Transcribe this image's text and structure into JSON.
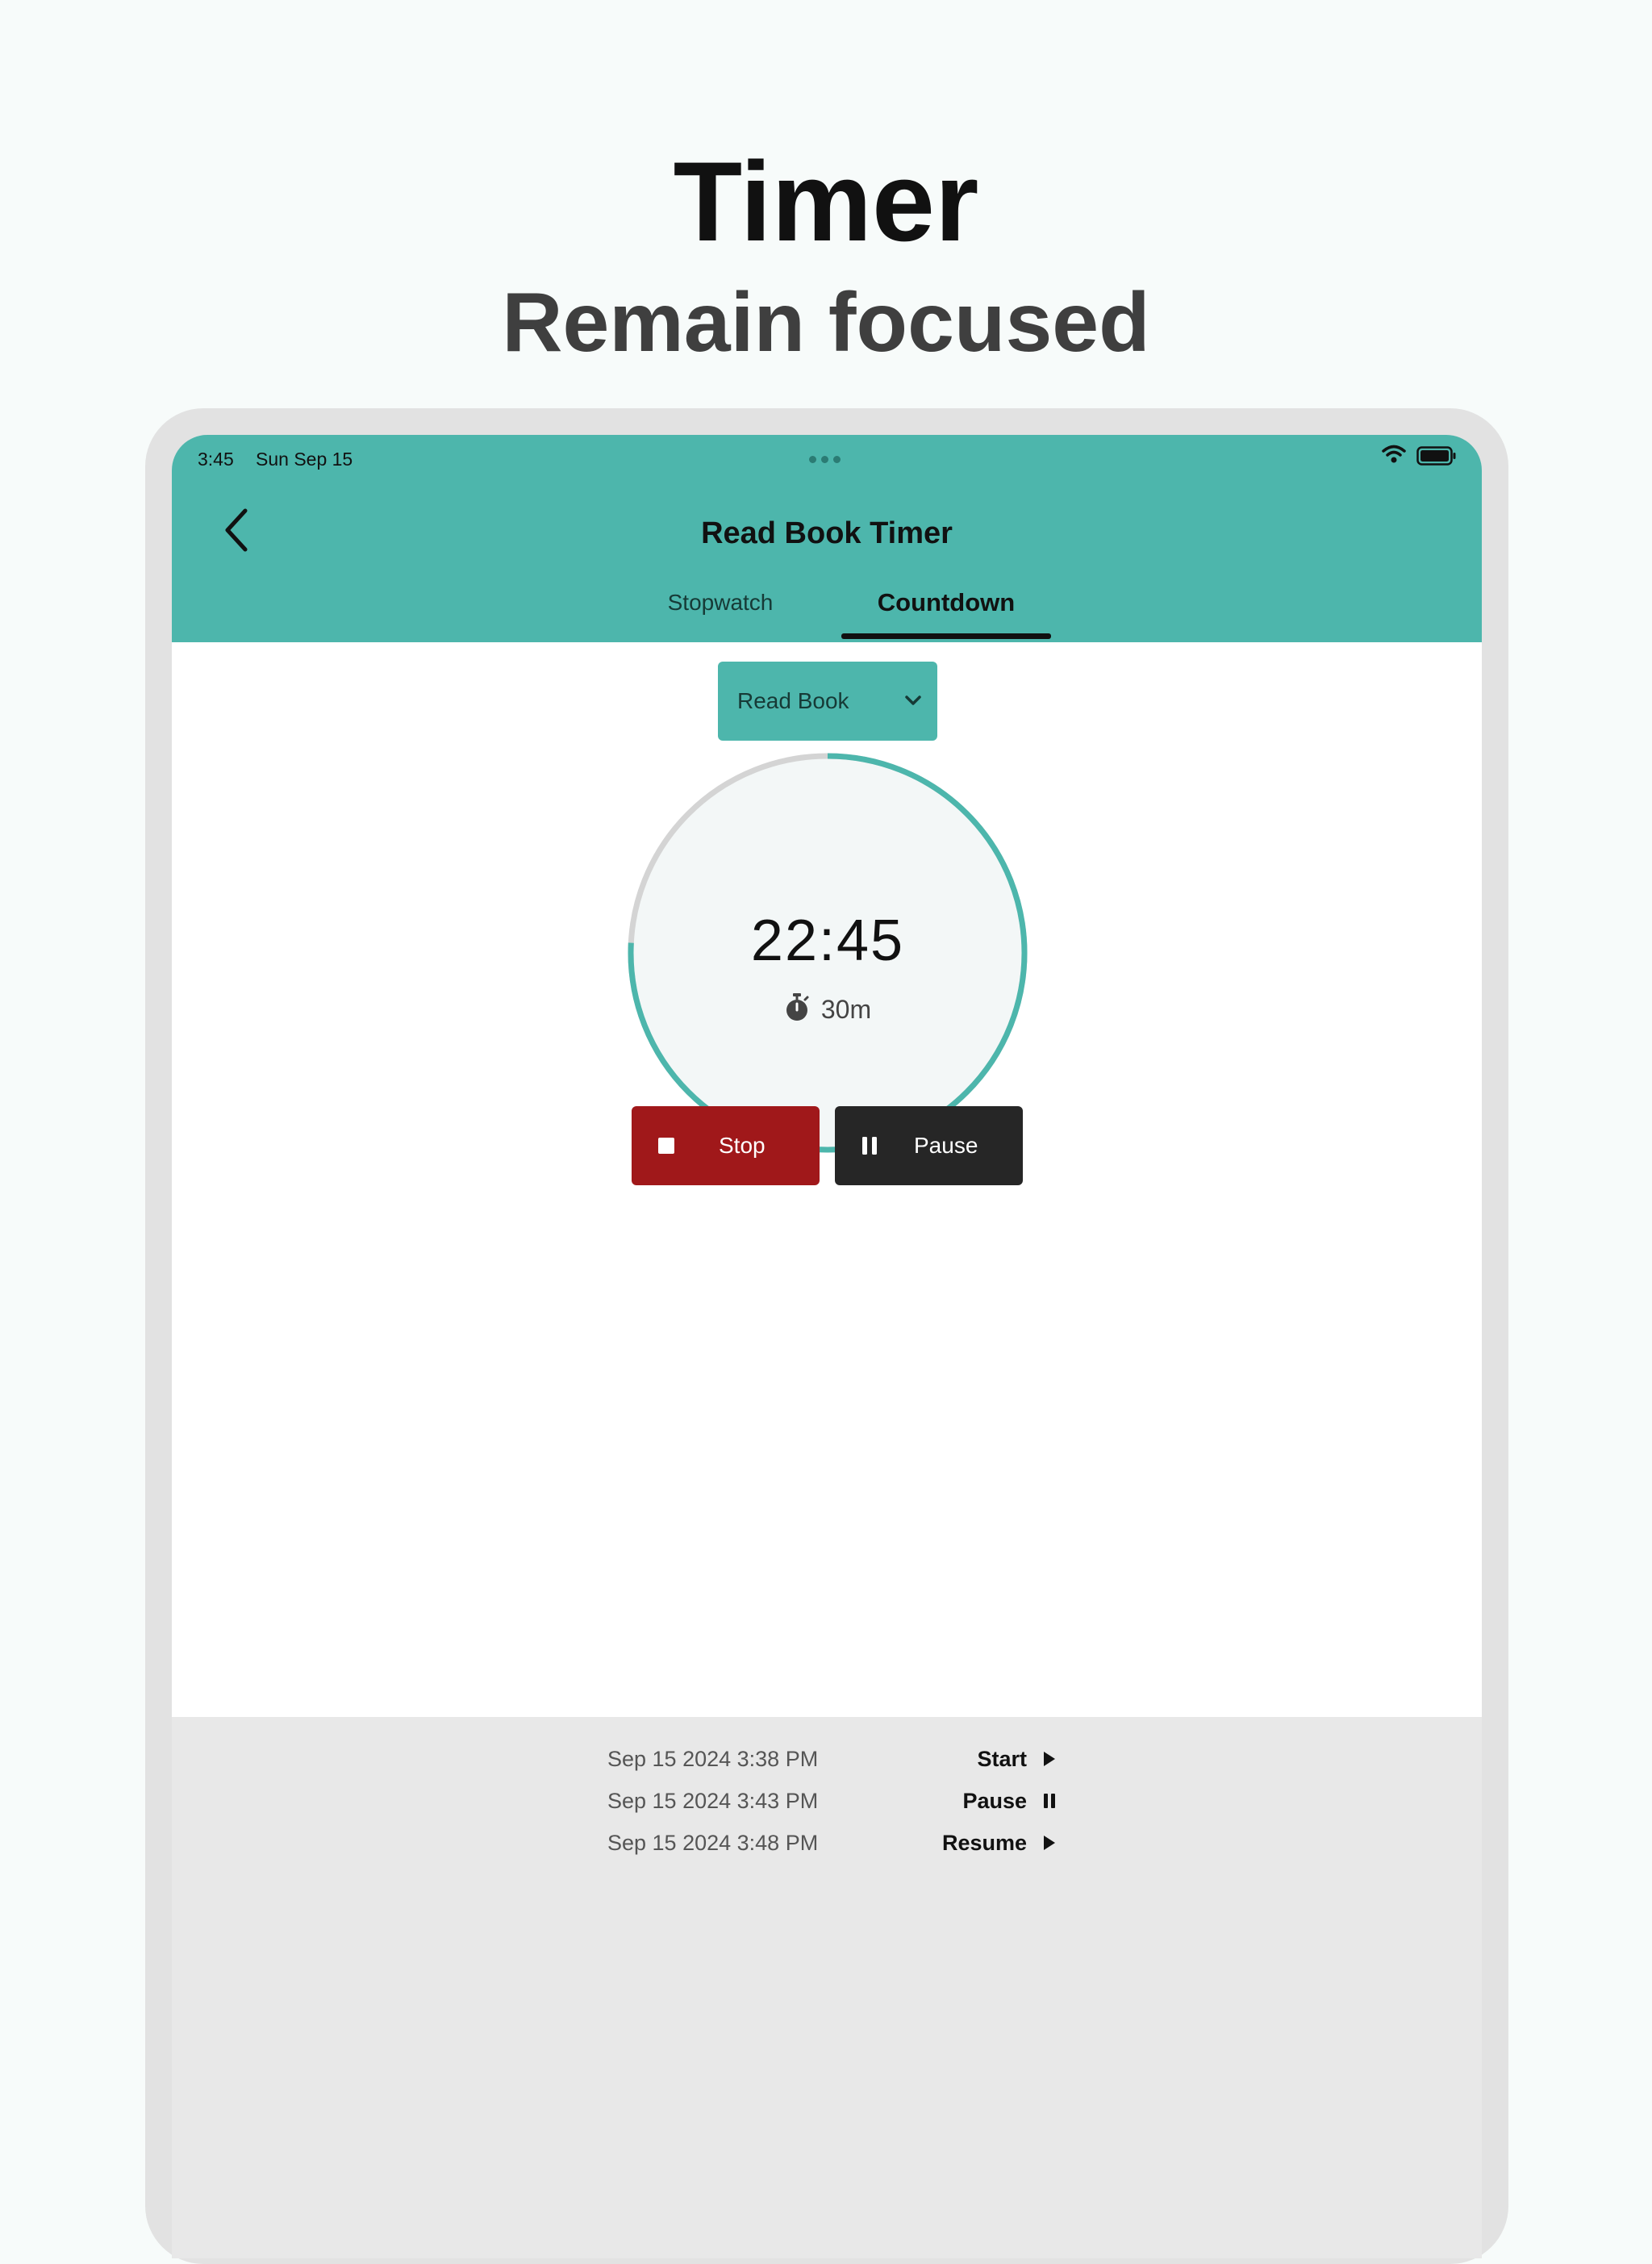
{
  "page": {
    "headline": "Timer",
    "subheadline": "Remain focused"
  },
  "status_bar": {
    "time": "3:45",
    "date": "Sun Sep 15",
    "wifi_icon": "wifi-icon",
    "battery_icon": "battery-icon"
  },
  "app_bar": {
    "title": "Read Book Timer",
    "back_icon": "chevron-left-icon",
    "tabs": [
      {
        "label": "Stopwatch",
        "selected": false
      },
      {
        "label": "Countdown",
        "selected": true
      }
    ]
  },
  "selector": {
    "value": "Read Book",
    "icon": "chevron-down-icon"
  },
  "countdown": {
    "remaining": "22:45",
    "duration": "30m",
    "duration_icon": "stopwatch-icon",
    "progress_fraction": 0.242
  },
  "controls": {
    "stop_label": "Stop",
    "pause_label": "Pause"
  },
  "log": [
    {
      "time": "Sep 15 2024 3:38 PM",
      "event": "Start",
      "icon": "play-icon"
    },
    {
      "time": "Sep 15 2024 3:43 PM",
      "event": "Pause",
      "icon": "pause-icon"
    },
    {
      "time": "Sep 15 2024 3:48 PM",
      "event": "Resume",
      "icon": "play-icon"
    }
  ],
  "colors": {
    "accent": "#4db6ac",
    "track": "#d4d4d4",
    "dial_bg": "#f3f7f7",
    "stop": "#a0181a",
    "pause": "#262626"
  }
}
